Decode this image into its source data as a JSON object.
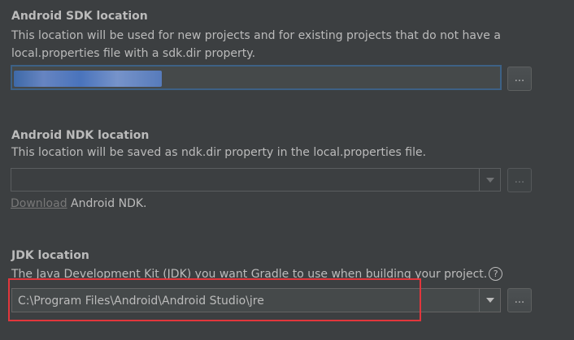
{
  "sdk": {
    "title": "Android SDK location",
    "description": "This location will be used for new projects and for existing projects that do not have a local.properties file with a sdk.dir property.",
    "value": "",
    "browse_label": "..."
  },
  "ndk": {
    "title": "Android NDK location",
    "description": "This location will be saved as ndk.dir property in the local.properties file.",
    "value": "",
    "browse_label": "...",
    "download_link": "Download",
    "download_suffix": " Android NDK."
  },
  "jdk": {
    "title": "JDK location",
    "description": "The Java Development Kit (JDK) you want Gradle to use when building your project.",
    "help_glyph": "?",
    "value": "C:\\Program Files\\Android\\Android Studio\\jre",
    "browse_label": "..."
  },
  "colors": {
    "background": "#3c3f41",
    "text": "#bbbbbb",
    "focus_border": "#3d6185",
    "highlight_box": "#e2363c",
    "link": "#787878"
  }
}
